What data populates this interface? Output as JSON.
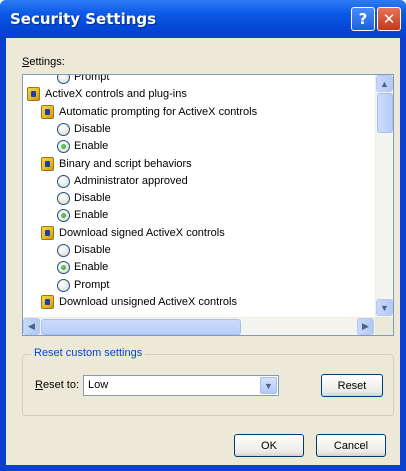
{
  "window": {
    "title": "Security Settings",
    "help_glyph": "?",
    "close_glyph": "✕"
  },
  "settings_label_prefix": "S",
  "settings_label_rest": "ettings:",
  "list": [
    {
      "type": "radio",
      "label": "Prompt",
      "checked": false
    },
    {
      "type": "category",
      "label": "ActiveX controls and plug-ins"
    },
    {
      "type": "subcategory",
      "label": "Automatic prompting for ActiveX controls"
    },
    {
      "type": "radio",
      "label": "Disable",
      "checked": false
    },
    {
      "type": "radio",
      "label": "Enable",
      "checked": true
    },
    {
      "type": "subcategory",
      "label": "Binary and script behaviors"
    },
    {
      "type": "radio",
      "label": "Administrator approved",
      "checked": false
    },
    {
      "type": "radio",
      "label": "Disable",
      "checked": false
    },
    {
      "type": "radio",
      "label": "Enable",
      "checked": true
    },
    {
      "type": "subcategory",
      "label": "Download signed ActiveX controls"
    },
    {
      "type": "radio",
      "label": "Disable",
      "checked": false
    },
    {
      "type": "radio",
      "label": "Enable",
      "checked": true
    },
    {
      "type": "radio",
      "label": "Prompt",
      "checked": false
    },
    {
      "type": "subcategory",
      "label": "Download unsigned ActiveX controls"
    }
  ],
  "scrollbar": {
    "up_glyph": "▲",
    "down_glyph": "▼",
    "left_glyph": "◀",
    "right_glyph": "▶"
  },
  "reset_group": {
    "legend": "Reset custom settings",
    "label_prefix": "R",
    "label_rest": "eset to:",
    "dropdown_value": "Low",
    "dropdown_glyph": "▼",
    "reset_button_label": "Reset"
  },
  "buttons": {
    "ok": "OK",
    "cancel": "Cancel"
  }
}
